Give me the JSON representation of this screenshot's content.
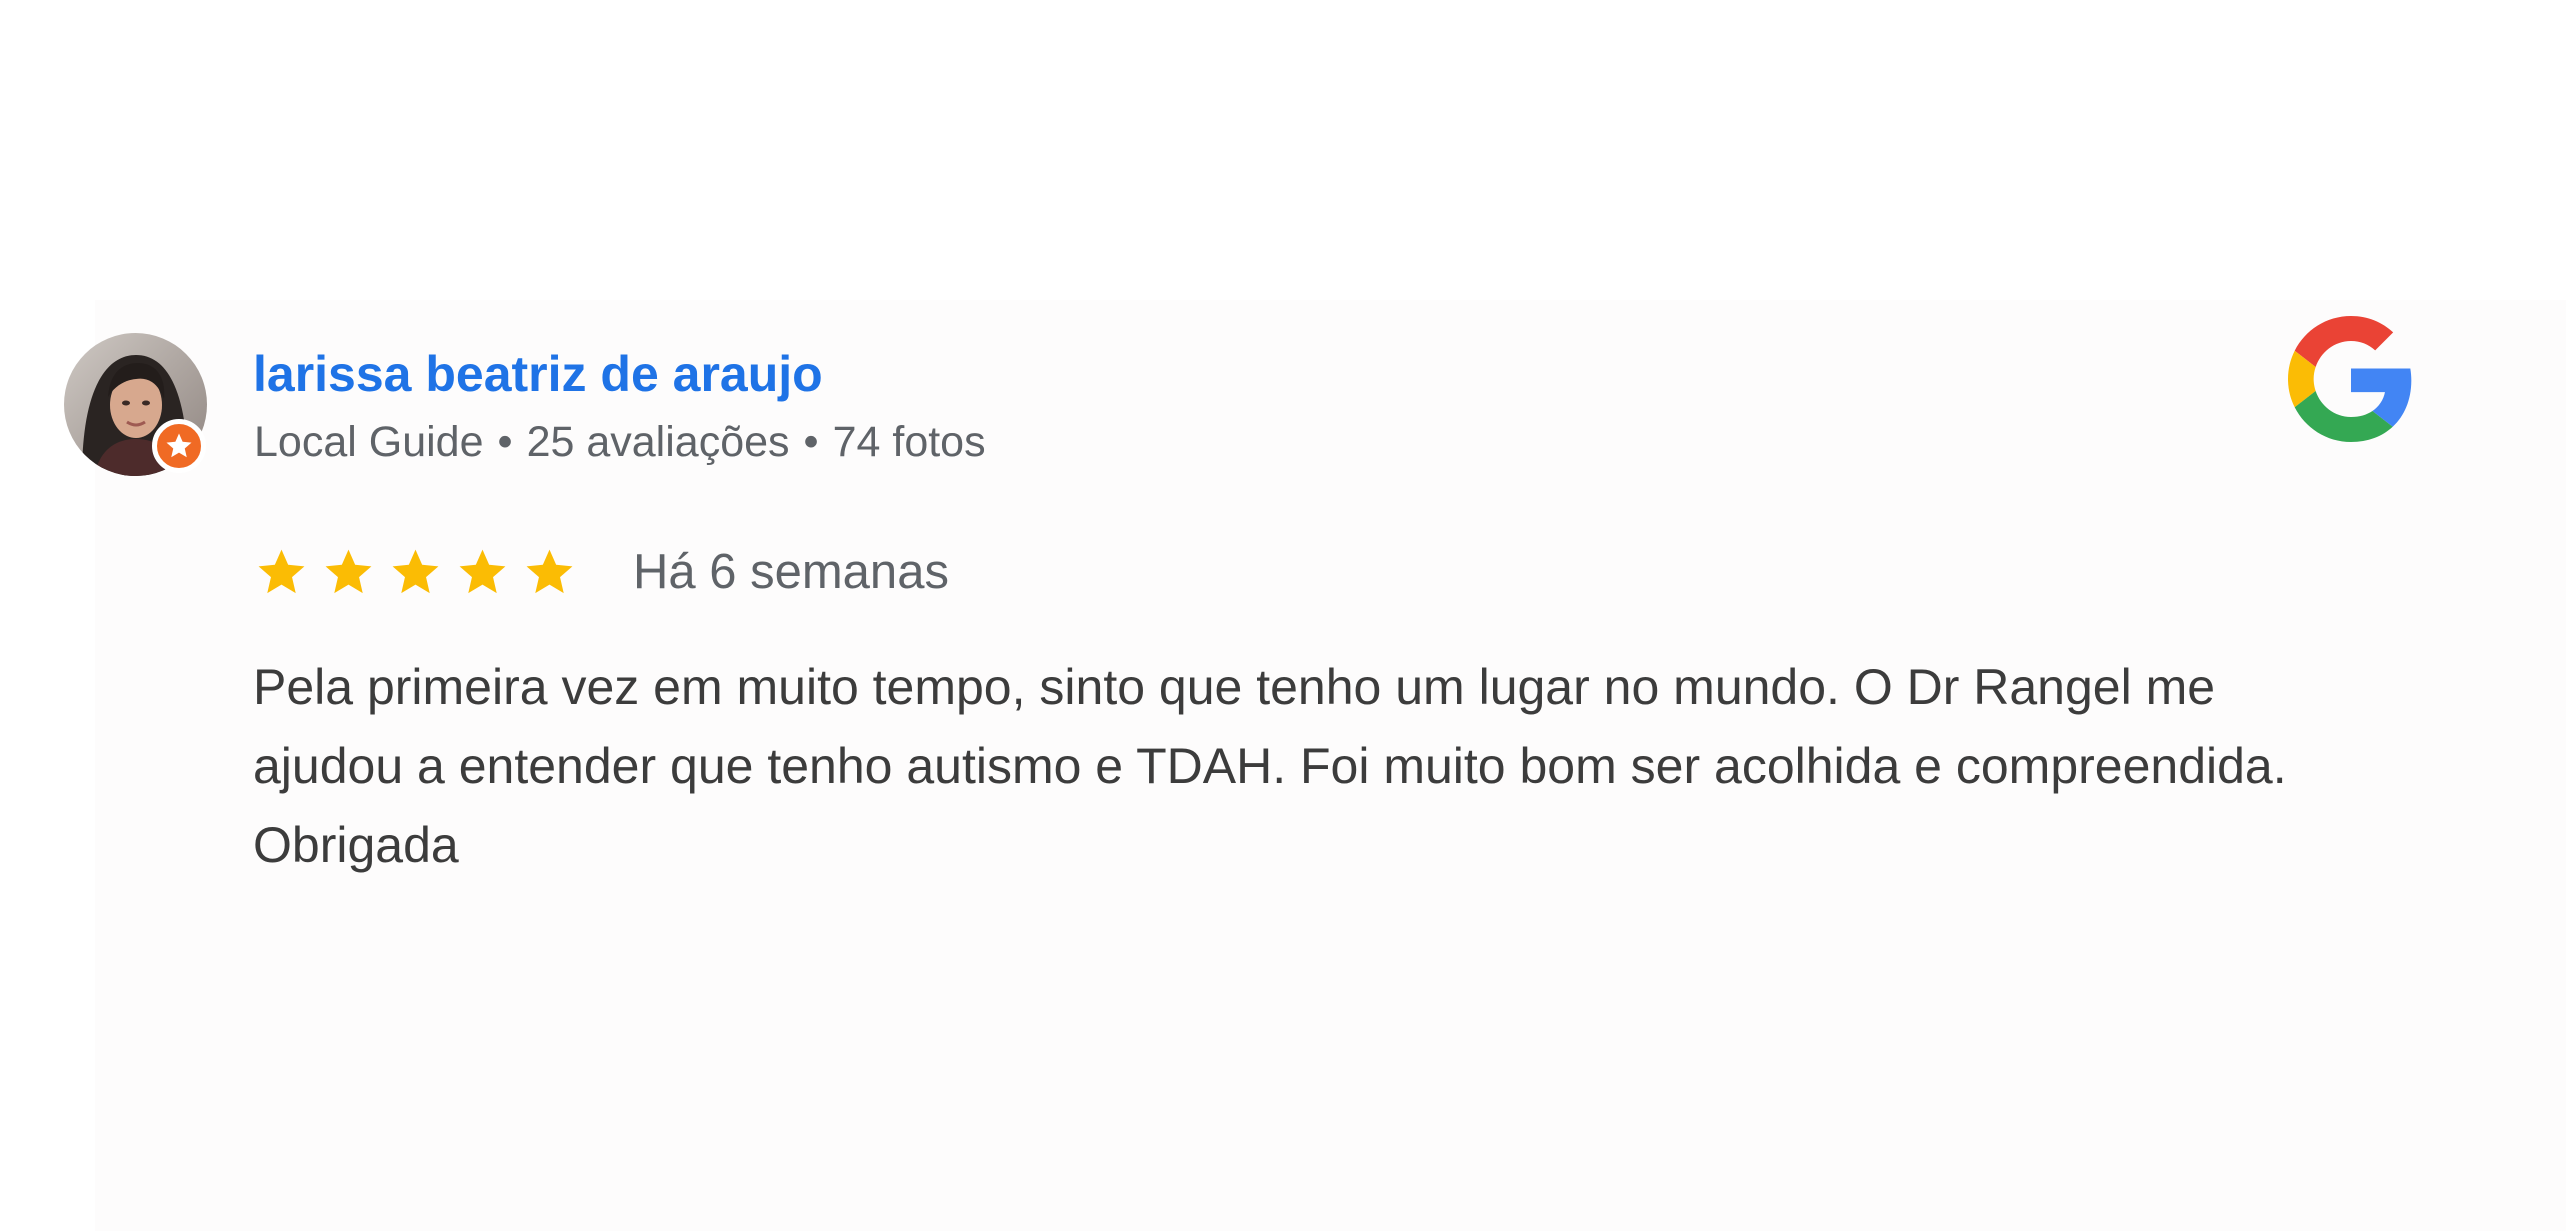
{
  "review": {
    "author_name": "larissa beatriz de araujo",
    "author_level": "Local Guide",
    "separator": "•",
    "reviews_count": "25 avaliações",
    "photos_count": "74 fotos",
    "rating": 5,
    "rating_max": 5,
    "date": "Há 6 semanas",
    "text_lines": [
      "Pela primeira vez em muito tempo, sinto que tenho um lugar no mundo. O Dr Rangel me",
      "ajudou a entender que tenho autismo e TDAH. Foi muito bom ser acolhida e compreendida.",
      "Obrigada"
    ]
  },
  "icons": {
    "avatar": "user-photo",
    "badge": "local-guide-star-icon",
    "brand": "google-g-logo",
    "rating": "star-icon"
  },
  "colors": {
    "author_name": "#1f73e6",
    "meta_text": "#5f6368",
    "body_text": "#3c3c3c",
    "star": "#fbbc04",
    "badge": "#f06a24",
    "google_blue": "#4285f4",
    "google_red": "#ea4335",
    "google_yellow": "#fbbc05",
    "google_green": "#34a853"
  }
}
